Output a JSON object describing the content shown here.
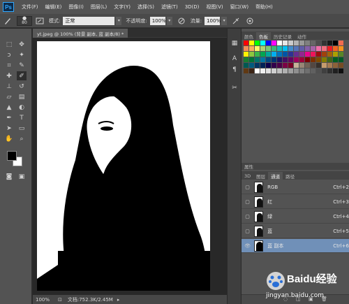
{
  "menubar": {
    "items": [
      "文件(F)",
      "编辑(E)",
      "图像(I)",
      "图层(L)",
      "文字(Y)",
      "选择(S)",
      "滤镜(T)",
      "3D(D)",
      "视图(V)",
      "窗口(W)",
      "帮助(H)"
    ],
    "logo": "Ps"
  },
  "options": {
    "brush_size": "80",
    "mode_label": "模式:",
    "mode_value": "正常",
    "opacity_label": "不透明度:",
    "opacity_value": "100%",
    "flow_label": "流量:",
    "flow_value": "100%"
  },
  "document": {
    "tab_title": "yt.jpeg @ 100% (背景 副本, 蓝 副本/8) *",
    "zoom": "100%",
    "doc_size": "文档:752.3K/2.45M"
  },
  "panels": {
    "top_tabs": [
      "颜色",
      "色板",
      "历史记录",
      "动作"
    ],
    "bottom_tabs_header": "属性",
    "bottom_tabs": [
      "3D",
      "图层",
      "通道",
      "路径"
    ]
  },
  "channels": [
    {
      "name": "RGB",
      "shortcut": "Ctrl+2",
      "selected": false
    },
    {
      "name": "红",
      "shortcut": "Ctrl+3",
      "selected": false
    },
    {
      "name": "绿",
      "shortcut": "Ctrl+4",
      "selected": false
    },
    {
      "name": "蓝",
      "shortcut": "Ctrl+5",
      "selected": false
    },
    {
      "name": "蓝 副本",
      "shortcut": "Ctrl+6",
      "selected": true
    }
  ],
  "watermark": {
    "text": "Baidu经验",
    "url": "jingyan.baidu.com"
  },
  "colors": {
    "selection": "#7090b8",
    "panel": "#535353",
    "ps_blue": "#31a8ff"
  }
}
